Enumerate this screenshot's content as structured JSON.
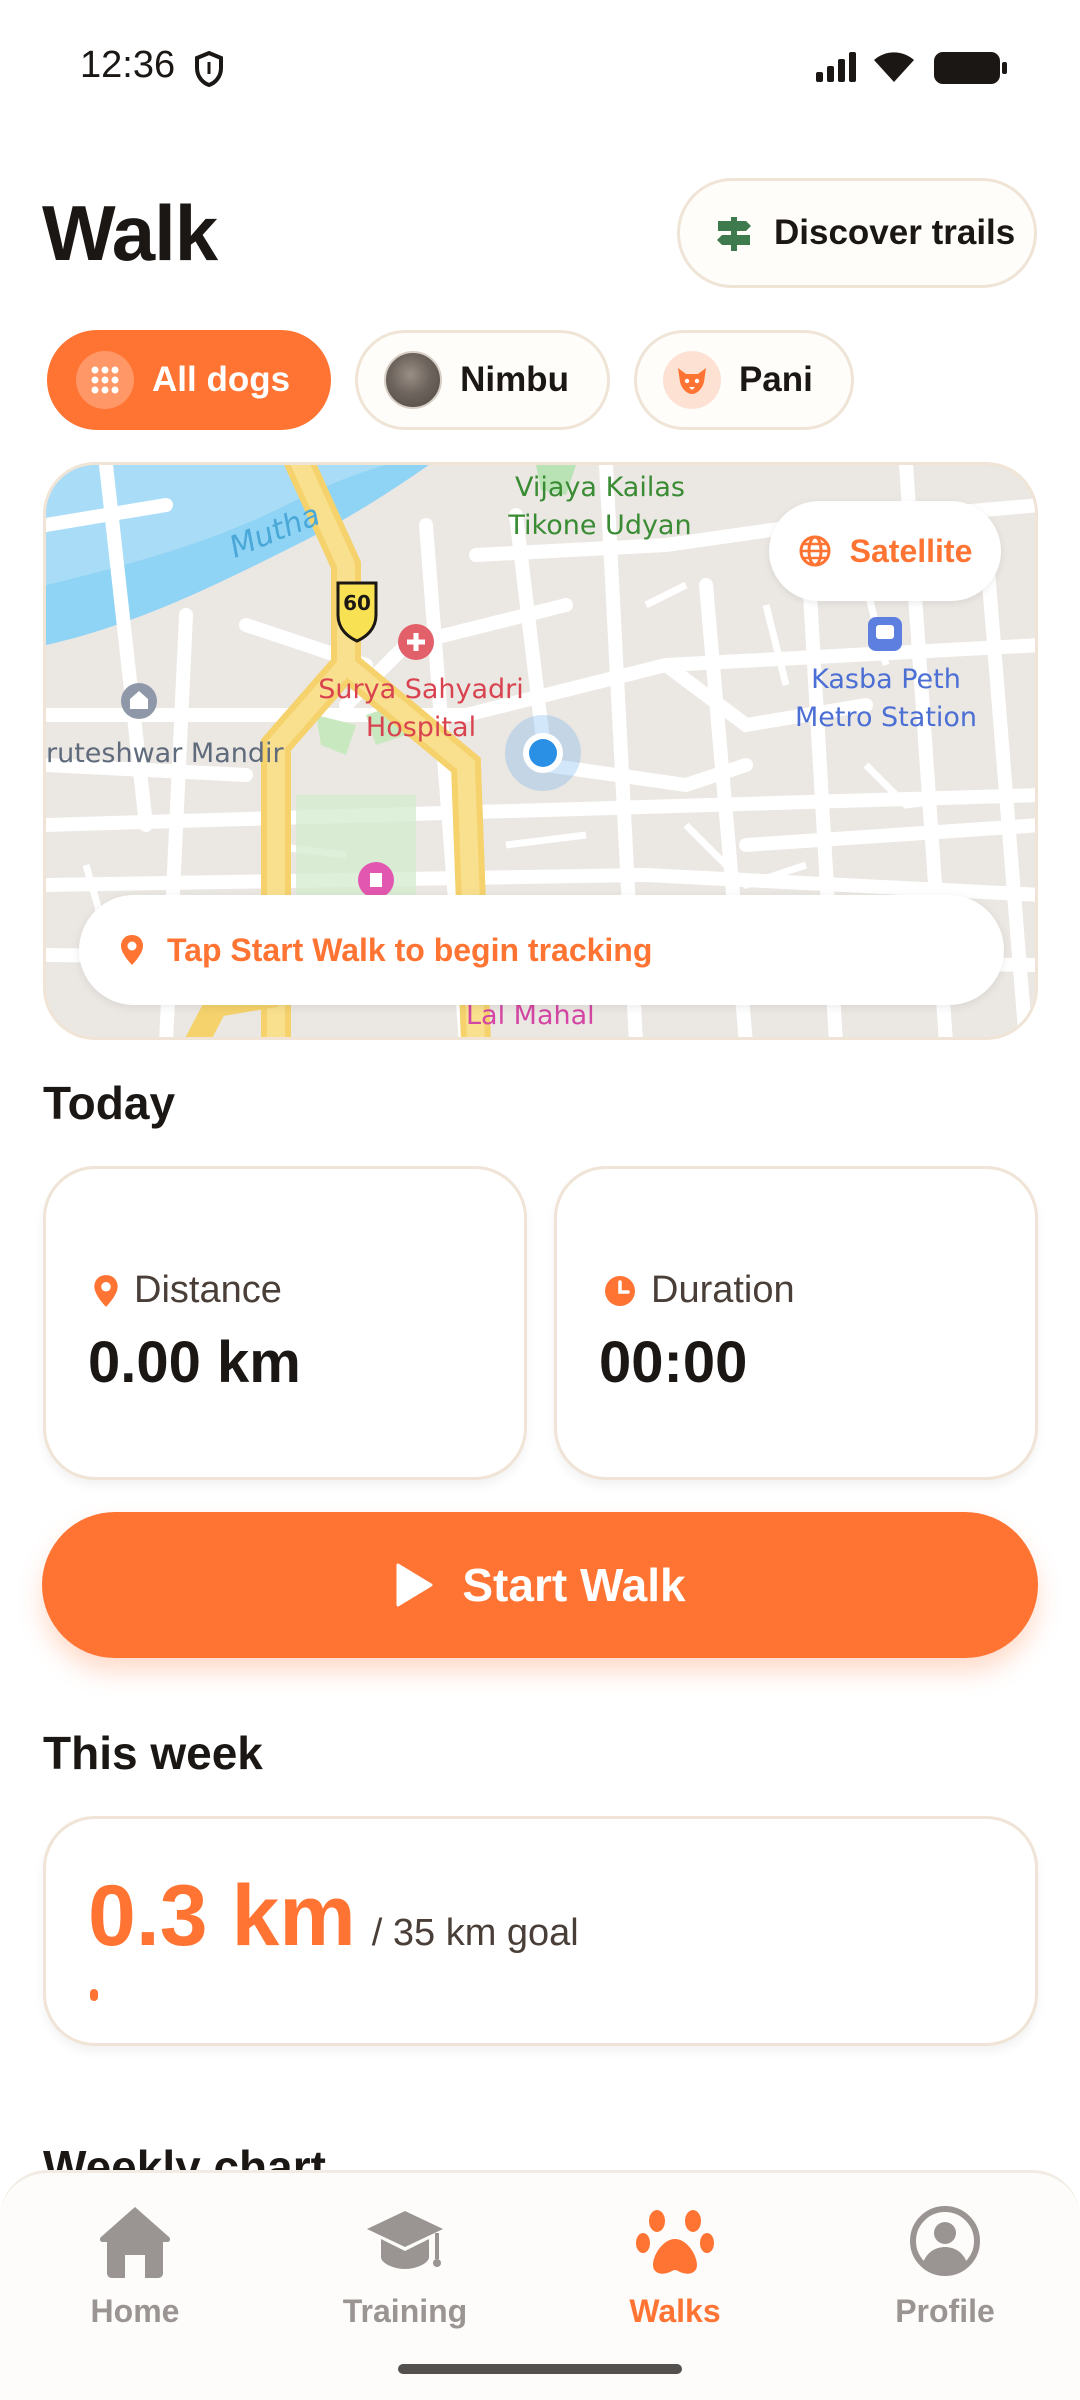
{
  "status_bar": {
    "time": "12:36"
  },
  "header": {
    "title": "Walk",
    "discover_label": "Discover trails"
  },
  "dog_filters": [
    {
      "label": "All dogs",
      "active": true,
      "icon": "grid-icon"
    },
    {
      "label": "Nimbu",
      "active": false,
      "icon": "dog-photo"
    },
    {
      "label": "Pani",
      "active": false,
      "icon": "dog-face-icon"
    }
  ],
  "map": {
    "satellite_label": "Satellite",
    "hint": "Tap Start Walk to begin tracking",
    "labels": {
      "river": "Mutha",
      "park": "Vijaya Kailas Tikone Udyan",
      "hospital": "Surya Sahyadri Hospital",
      "metro": "Kasba Peth Metro Station",
      "temple": "ruteshwar Mandir",
      "mahal": "Lal Mahal",
      "speed": "60"
    }
  },
  "today": {
    "title": "Today",
    "distance_label": "Distance",
    "distance_value": "0.00 km",
    "duration_label": "Duration",
    "duration_value": "00:00"
  },
  "start_button": {
    "label": "Start Walk"
  },
  "this_week": {
    "title": "This week",
    "value": "0.3 km",
    "goal": "/ 35 km goal",
    "progress_fraction": 0.0086
  },
  "weekly_chart": {
    "title": "Weekly chart"
  },
  "bottom_nav": {
    "items": [
      {
        "label": "Home",
        "icon": "home-icon"
      },
      {
        "label": "Training",
        "icon": "graduation-cap-icon"
      },
      {
        "label": "Walks",
        "icon": "paw-icon",
        "active": true
      },
      {
        "label": "Profile",
        "icon": "profile-icon"
      }
    ]
  },
  "colors": {
    "accent": "#ff7433",
    "inactive": "#9a9593",
    "border": "#efe4d6"
  }
}
